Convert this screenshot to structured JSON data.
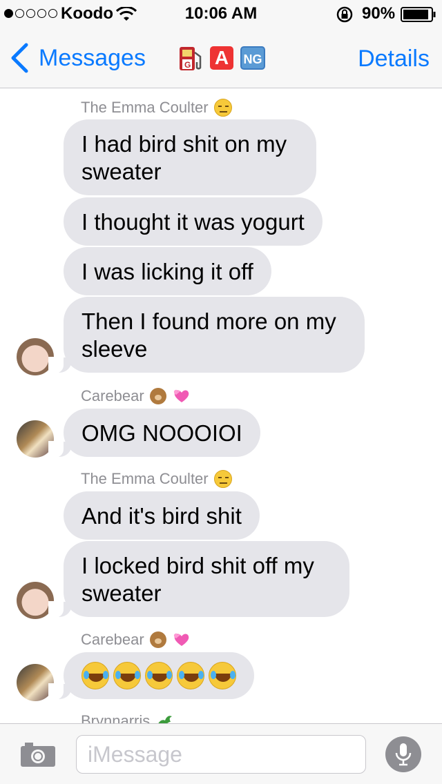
{
  "status_bar": {
    "signal_dots_filled": 1,
    "signal_dots_total": 5,
    "carrier": "Koodo",
    "time": "10:06 AM",
    "battery_percent": "90%",
    "battery_level": 0.9
  },
  "nav": {
    "back_label": "Messages",
    "title_icons": [
      "fuel-pump-icon",
      "letter-a-icon",
      "ng-icon"
    ],
    "title_ng_text": "NG",
    "title_a_text": "A",
    "details_label": "Details",
    "accent_color": "#0a7aff"
  },
  "conversation": [
    {
      "sender": "The Emma Coulter",
      "sender_emoji": [
        "expressionless-face-icon"
      ],
      "messages": [
        "I had bird shit on my sweater",
        "I thought it was yogurt",
        "I was licking it off",
        "Then I found more on my sleeve"
      ]
    },
    {
      "sender": "Carebear",
      "sender_emoji": [
        "bear-icon",
        "hearts-icon"
      ],
      "messages": [
        "OMG NOOOIOI"
      ]
    },
    {
      "sender": "The Emma Coulter",
      "sender_emoji": [
        "expressionless-face-icon"
      ],
      "messages": [
        "And it's bird shit",
        "I locked bird shit off my sweater"
      ]
    },
    {
      "sender": "Carebear",
      "sender_emoji": [
        "bear-icon",
        "hearts-icon"
      ],
      "messages": [
        "laughing-tears-emoji x5"
      ]
    },
    {
      "sender": "Brynnarris",
      "sender_emoji": [
        "dragon-icon"
      ],
      "messages": []
    }
  ],
  "input_bar": {
    "placeholder": "iMessage"
  },
  "colors": {
    "bubble_gray": "#e5e5ea",
    "sender_gray": "#8e8e93",
    "bar_bg": "#f7f7f7"
  }
}
